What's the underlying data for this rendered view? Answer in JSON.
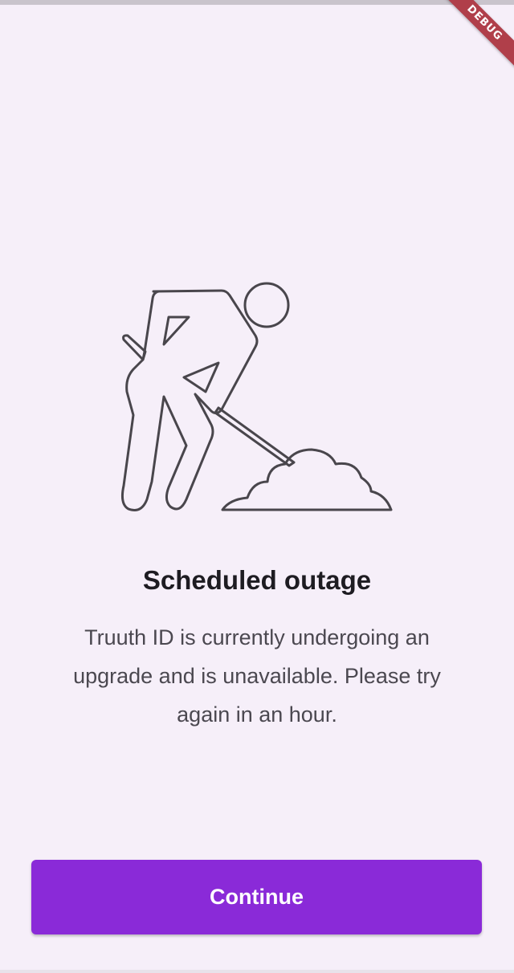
{
  "debug_banner": {
    "label": "DEBUG",
    "color": "#b03f4a"
  },
  "illustration": {
    "icon": "construction-worker-digging-icon"
  },
  "outage": {
    "title": "Scheduled outage",
    "message": "Truuth ID is currently undergoing an upgrade and is unavailable. Please try again in an hour."
  },
  "actions": {
    "continue_label": "Continue"
  },
  "colors": {
    "background": "#f6eff9",
    "accent": "#8a2ad8",
    "title_text": "#1e1c22",
    "body_text": "#4b4850",
    "illustration_stroke": "#49464c"
  }
}
